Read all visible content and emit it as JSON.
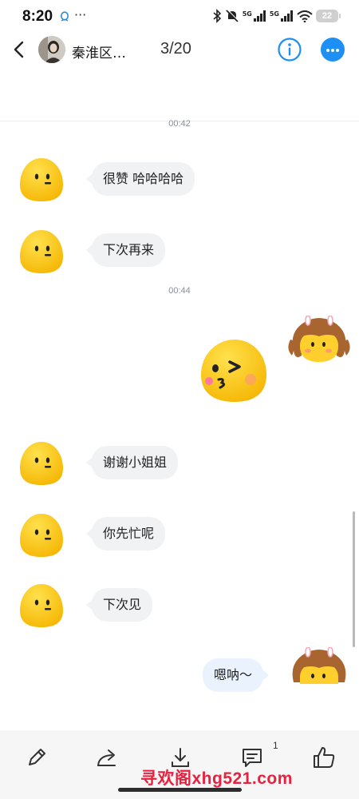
{
  "status_bar": {
    "time": "8:20",
    "overflow": "···",
    "network_1": "5G",
    "network_2": "5G",
    "battery": "22"
  },
  "header": {
    "contact_name": "秦淮区…",
    "counter": "3/20"
  },
  "messages": {
    "time_1": "00:42",
    "m1": "很赞 哈哈哈哈",
    "m2": "下次再来",
    "time_2": "00:44",
    "m3": "谢谢小姐姐",
    "m4": "你先忙呢",
    "m5": "下次见",
    "m6": "嗯呐～"
  },
  "toolbar": {
    "comment_count": "1",
    "watermark": "寻欢阁xhg521.com"
  },
  "colors": {
    "accent": "#1e8ff5",
    "bubble_gray": "#f1f2f4",
    "bubble_blue": "#e9f2fd",
    "watermark": "#e8213f"
  },
  "icons": [
    "qq-icon",
    "bluetooth-icon",
    "mute-icon",
    "signal-icon",
    "wifi-icon",
    "battery-icon",
    "back-arrow-icon",
    "info-icon",
    "more-icon",
    "edit-icon",
    "share-icon",
    "download-icon",
    "comment-icon",
    "like-icon"
  ]
}
